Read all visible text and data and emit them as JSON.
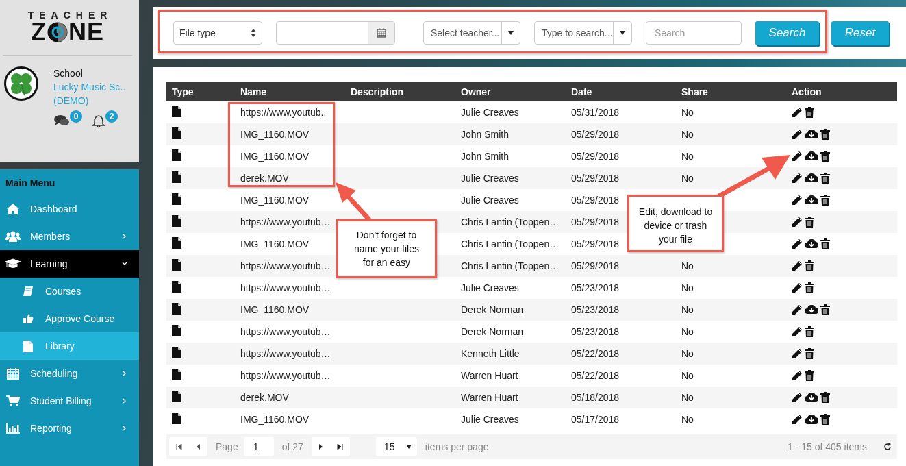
{
  "logo": {
    "line1": "TEACHER",
    "line2_start": "Z",
    "line2_end": "NE"
  },
  "profile": {
    "label": "School",
    "name": "Lucky Music Sc..",
    "name_line2": "(DEMO)",
    "messages": "0",
    "notifications": "2"
  },
  "menu": {
    "title": "Main Menu",
    "items": [
      {
        "label": "Dashboard",
        "selected": false
      },
      {
        "label": "Members",
        "selected": false,
        "expanded": false
      },
      {
        "label": "Learning",
        "selected": false,
        "expanded": true,
        "children": [
          {
            "label": "Courses",
            "selected": false
          },
          {
            "label": "Approve Course",
            "selected": false
          },
          {
            "label": "Library",
            "selected": true
          }
        ]
      },
      {
        "label": "Scheduling",
        "selected": false,
        "expanded": false
      },
      {
        "label": "Student Billing",
        "selected": false,
        "expanded": false
      },
      {
        "label": "Reporting",
        "selected": false,
        "expanded": false
      }
    ]
  },
  "filters": [
    {
      "kind": "select",
      "value": "File type"
    },
    {
      "kind": "date"
    },
    {
      "kind": "combo",
      "placeholder": "Select teacher..."
    },
    {
      "kind": "combo",
      "placeholder": "Type to search..."
    },
    {
      "kind": "text",
      "placeholder": "Search"
    }
  ],
  "search_button": "Search",
  "reset_button": "Reset",
  "table": {
    "columns": [
      "Type",
      "Name",
      "Description",
      "Owner",
      "Date",
      "Share",
      "Action"
    ],
    "rows": [
      {
        "name": "https://www.youtub..",
        "owner": "Julie Creaves",
        "date": "05/31/2018",
        "share": "No",
        "downloadable": false
      },
      {
        "name": "IMG_1160.MOV",
        "owner": "John Smith",
        "date": "05/29/2018",
        "share": "No",
        "downloadable": true
      },
      {
        "name": "IMG_1160.MOV",
        "owner": "John Smith",
        "date": "05/29/2018",
        "share": "No",
        "downloadable": true
      },
      {
        "name": "derek.MOV",
        "owner": "Julie Creaves",
        "date": "05/29/2018",
        "share": "No",
        "downloadable": true
      },
      {
        "name": "IMG_1160.MOV",
        "owner": "Julie Creaves",
        "date": "05/29/2018",
        "downloadable": true
      },
      {
        "name": "https://www.youtub…",
        "owner": "Chris Lantin (Toppen…",
        "date": "05/29/2018",
        "downloadable": false
      },
      {
        "name": "IMG_1160.MOV",
        "owner": "Chris Lantin (Toppen…",
        "date": "05/29/2018",
        "downloadable": true
      },
      {
        "name": "https://www.youtub…",
        "owner": "Chris Lantin (Toppen…",
        "date": "05/29/2018",
        "share": "No",
        "downloadable": false
      },
      {
        "name": "https://www.youtub…",
        "owner": "Julie Creaves",
        "date": "05/23/2018",
        "share": "No",
        "downloadable": false
      },
      {
        "name": "IMG_1160.MOV",
        "owner": "Derek Norman",
        "date": "05/23/2018",
        "share": "No",
        "downloadable": true
      },
      {
        "name": "https://www.youtub…",
        "owner": "Derek Norman",
        "date": "05/23/2018",
        "share": "No",
        "downloadable": false
      },
      {
        "name": "https://www.youtub…",
        "owner": "Kenneth Little",
        "date": "05/22/2018",
        "share": "No",
        "downloadable": false
      },
      {
        "name": "https://www.youtub…",
        "owner": "Warren Huart",
        "date": "05/22/2018",
        "share": "No",
        "downloadable": false
      },
      {
        "name": "derek.MOV",
        "owner": "Warren Huart",
        "date": "05/18/2018",
        "share": "No",
        "downloadable": true
      },
      {
        "name": "IMG_1160.MOV",
        "owner": "Julie Creaves",
        "date": "05/17/2018",
        "share": "No",
        "downloadable": true
      }
    ]
  },
  "pagination": {
    "page_label": "Page",
    "page": "1",
    "of": "of 27",
    "per_page": "15",
    "per_page_label": "items per page",
    "summary": "1 - 15 of 405 items"
  },
  "callouts": [
    {
      "text": "Don't forget to name your files for an easy"
    },
    {
      "text": "Edit, download to device or trash your file"
    }
  ]
}
